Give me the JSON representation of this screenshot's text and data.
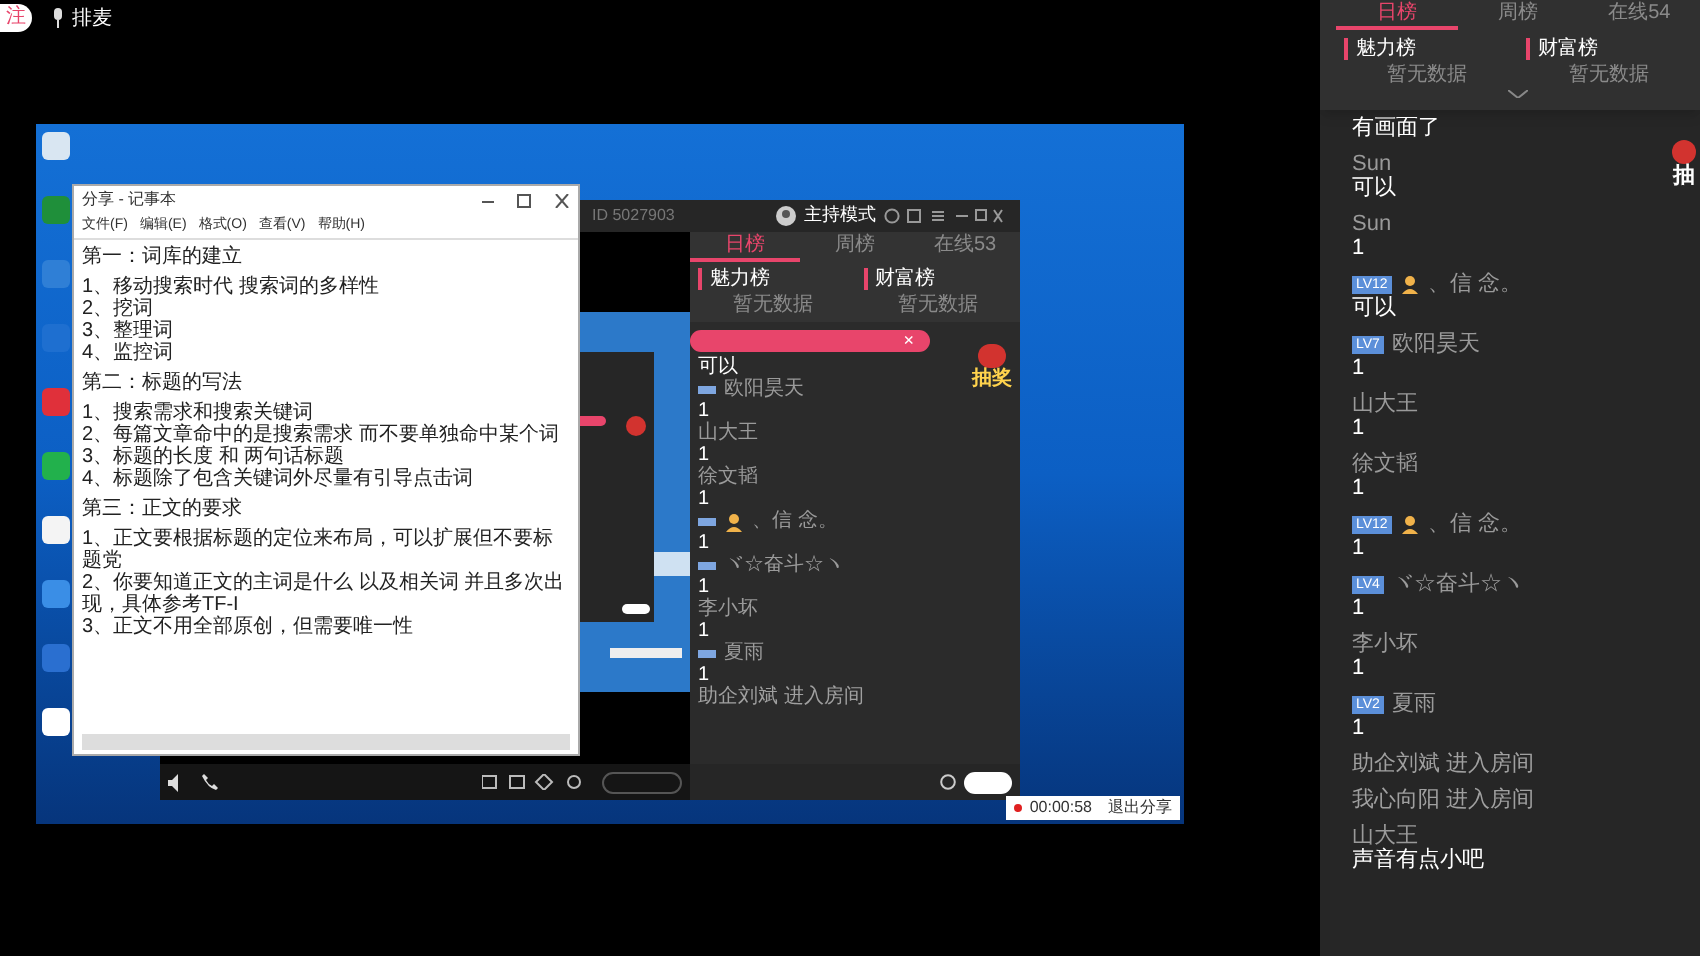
{
  "top_bar": {
    "follow_button": "注",
    "mic_queue": "排麦"
  },
  "notepad": {
    "title": "分享 - 记事本",
    "menu": [
      "文件(F)",
      "编辑(E)",
      "格式(O)",
      "查看(V)",
      "帮助(H)"
    ],
    "sections": [
      {
        "heading": "第一：词库的建立",
        "items": [
          "1、移动搜索时代 搜索词的多样性",
          "2、挖词",
          "3、整理词",
          "4、监控词"
        ]
      },
      {
        "heading": "第二：标题的写法",
        "items": [
          "1、搜索需求和搜索关键词",
          "2、每篇文章命中的是搜索需求 而不要单独命中某个词",
          "3、标题的长度 和 两句话标题",
          "4、标题除了包含关键词外尽量有引导点击词"
        ]
      },
      {
        "heading": "第三：正文的要求",
        "items": [
          "1、正文要根据标题的定位来布局，可以扩展但不要标题党",
          "2、你要知道正文的主词是什么 以及相关词 并且多次出现，具体参考TF-I",
          "3、正文不用全部原创，但需要唯一性"
        ]
      }
    ]
  },
  "meeting_window": {
    "room_id": "ID 5027903",
    "mode": "主持模式",
    "tabs": [
      {
        "label": "日榜",
        "selected": true
      },
      {
        "label": "周榜",
        "selected": false
      },
      {
        "label": "在线53",
        "selected": false
      }
    ],
    "boards": [
      {
        "title": "魅力榜",
        "status": "暂无数据"
      },
      {
        "title": "财富榜",
        "status": "暂无数据"
      }
    ],
    "banner_close": "×",
    "lottery": "抽奖",
    "chat": [
      {
        "kind": "text",
        "text": "可以"
      },
      {
        "kind": "message",
        "level_badge": true,
        "avatar": false,
        "name": "欧阳昊天",
        "text": "1"
      },
      {
        "kind": "message",
        "level_badge": false,
        "avatar": false,
        "name": "山大王",
        "text": "1"
      },
      {
        "kind": "message",
        "level_badge": false,
        "avatar": false,
        "name": "徐文韬",
        "text": "1"
      },
      {
        "kind": "message",
        "level_badge": true,
        "avatar": true,
        "name": "、信 念。",
        "text": "1"
      },
      {
        "kind": "message",
        "level_badge": true,
        "avatar": false,
        "name": "ヾ☆奋斗☆ヽ",
        "text": "1"
      },
      {
        "kind": "message",
        "level_badge": false,
        "avatar": false,
        "name": "李小坏",
        "text": "1"
      },
      {
        "kind": "message",
        "level_badge": true,
        "avatar": false,
        "name": "夏雨",
        "text": "1"
      },
      {
        "kind": "join",
        "text": "助企刘斌 进入房间"
      }
    ]
  },
  "recording": {
    "time": "00:00:58",
    "stop": "退出分享"
  },
  "side_panel": {
    "tabs": [
      {
        "label": "日榜",
        "selected": true
      },
      {
        "label": "周榜",
        "selected": false
      },
      {
        "label": "在线54",
        "selected": false
      }
    ],
    "boards": [
      {
        "title": "魅力榜",
        "status": "暂无数据"
      },
      {
        "title": "财富榜",
        "status": "暂无数据"
      }
    ],
    "lottery": "抽",
    "chat": [
      {
        "kind": "text",
        "text": "有画面了"
      },
      {
        "kind": "message",
        "avatar": false,
        "name": "Sun",
        "text": "可以"
      },
      {
        "kind": "message",
        "avatar": false,
        "name": "Sun",
        "text": "1"
      },
      {
        "kind": "message",
        "level": "LV12",
        "avatar": true,
        "name": "、信 念。",
        "text": "可以"
      },
      {
        "kind": "message",
        "level": "LV7",
        "avatar": false,
        "name": "欧阳昊天",
        "text": "1"
      },
      {
        "kind": "message",
        "avatar": false,
        "name": "山大王",
        "text": "1"
      },
      {
        "kind": "message",
        "avatar": false,
        "name": "徐文韬",
        "text": "1"
      },
      {
        "kind": "message",
        "level": "LV12",
        "avatar": true,
        "name": "、信 念。",
        "text": "1"
      },
      {
        "kind": "message",
        "level": "LV4",
        "avatar": false,
        "name": "ヾ☆奋斗☆ヽ",
        "text": "1"
      },
      {
        "kind": "message",
        "avatar": false,
        "name": "李小坏",
        "text": "1"
      },
      {
        "kind": "message",
        "level": "LV2",
        "avatar": false,
        "name": "夏雨",
        "text": "1"
      },
      {
        "kind": "join",
        "text": "助企刘斌 进入房间"
      },
      {
        "kind": "join",
        "text": "我心向阳 进入房间"
      },
      {
        "kind": "message",
        "avatar": false,
        "name": "山大王",
        "text": "声音有点小吧"
      }
    ]
  }
}
